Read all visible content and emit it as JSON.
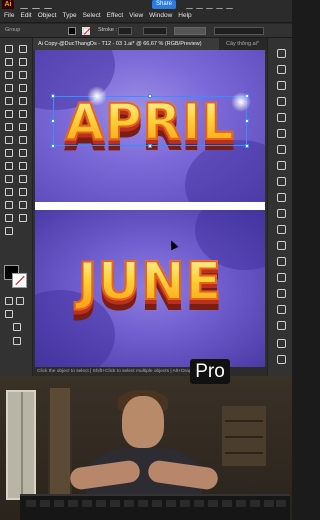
{
  "app": {
    "logo": "Ai"
  },
  "topbar": {
    "share_label": "Share"
  },
  "menu": [
    "File",
    "Edit",
    "Object",
    "Type",
    "Select",
    "Effect",
    "View",
    "Window",
    "Help"
  ],
  "control": {
    "group_label": "Group",
    "stroke_label": "Stroke :"
  },
  "tabs": [
    {
      "label": "Ai Copy-@DucThangDs - T12 - 03 1.ai* @ 66.67 % (RGB/Preview)",
      "active": true
    },
    {
      "label": "Cây thông.ai* ",
      "active": false
    }
  ],
  "artwork": {
    "word1": "APRIL",
    "word2": "JUNE"
  },
  "status": {
    "text": "Click the object to select  |  Shift+Click to select multiple objects  |  Alt+Drag to duplicate"
  },
  "badge": {
    "label": "Pro"
  },
  "colors": {
    "accent": "#2a7be4",
    "artboard": "#6f5ccd",
    "letters": "#ffd23a"
  }
}
